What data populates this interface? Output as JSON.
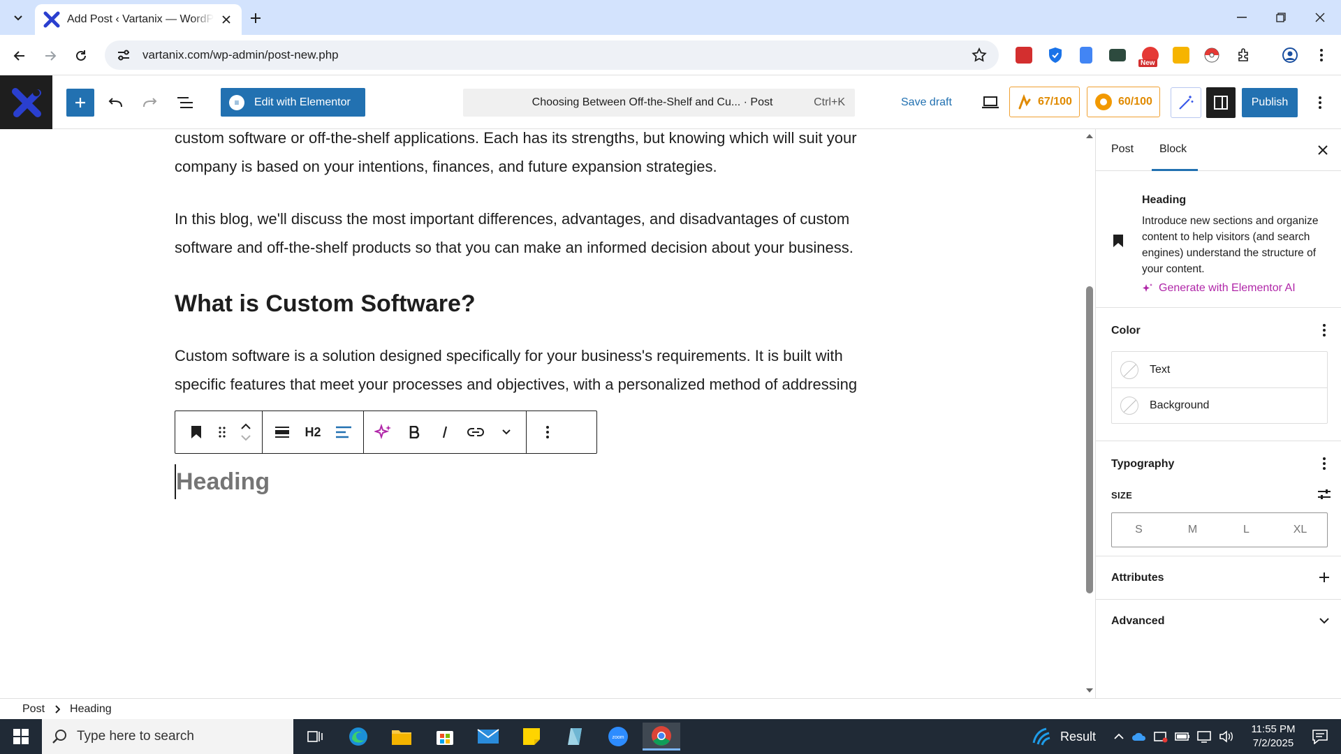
{
  "browser": {
    "tab_title": "Add Post ‹ Vartanix — WordPress",
    "url": "vartanix.com/wp-admin/post-new.php",
    "ext_badge": "New"
  },
  "header": {
    "elementor_label": "Edit with Elementor",
    "command_title": "Choosing Between Off-the-Shelf and Cu... · Post",
    "command_shortcut": "Ctrl+K",
    "save_draft": "Save draft",
    "seo_score": "67/100",
    "readability_score": "60/100",
    "publish": "Publish"
  },
  "content": {
    "para1": "custom software or off-the-shelf applications. Each has its strengths, but knowing which will suit your company is based on your intentions, finances, and future expansion strategies.",
    "para2": "In this blog, we'll discuss the most important differences, advantages, and disadvantages of custom software and off-the-shelf products so that you can make an informed decision about your business.",
    "h2": "What is Custom Software?",
    "para3": "Custom software is a solution designed specifically for your business's requirements. It is built with specific features that meet your processes and objectives, with a personalized method of addressing",
    "heading_placeholder": "Heading",
    "toolbar_level": "H2"
  },
  "sidebar": {
    "tab_post": "Post",
    "tab_block": "Block",
    "block_name": "Heading",
    "block_description": "Introduce new sections and organize content to help visitors (and search engines) understand the structure of your content.",
    "generate_label": "Generate with Elementor AI",
    "color_title": "Color",
    "color_text": "Text",
    "color_background": "Background",
    "typography_title": "Typography",
    "size_label": "SIZE",
    "sizes": [
      "S",
      "M",
      "L",
      "XL"
    ],
    "attributes_title": "Attributes",
    "advanced_title": "Advanced"
  },
  "breadcrumb": {
    "root": "Post",
    "current": "Heading"
  },
  "taskbar": {
    "search_placeholder": "Type here to search",
    "weather": "Result",
    "time": "11:55 PM",
    "date": "7/2/2025"
  },
  "colors": {
    "wp_blue": "#2271b1",
    "score_orange": "#e08a00",
    "ai_magenta": "#b026a8",
    "taskbar": "#202a36"
  }
}
